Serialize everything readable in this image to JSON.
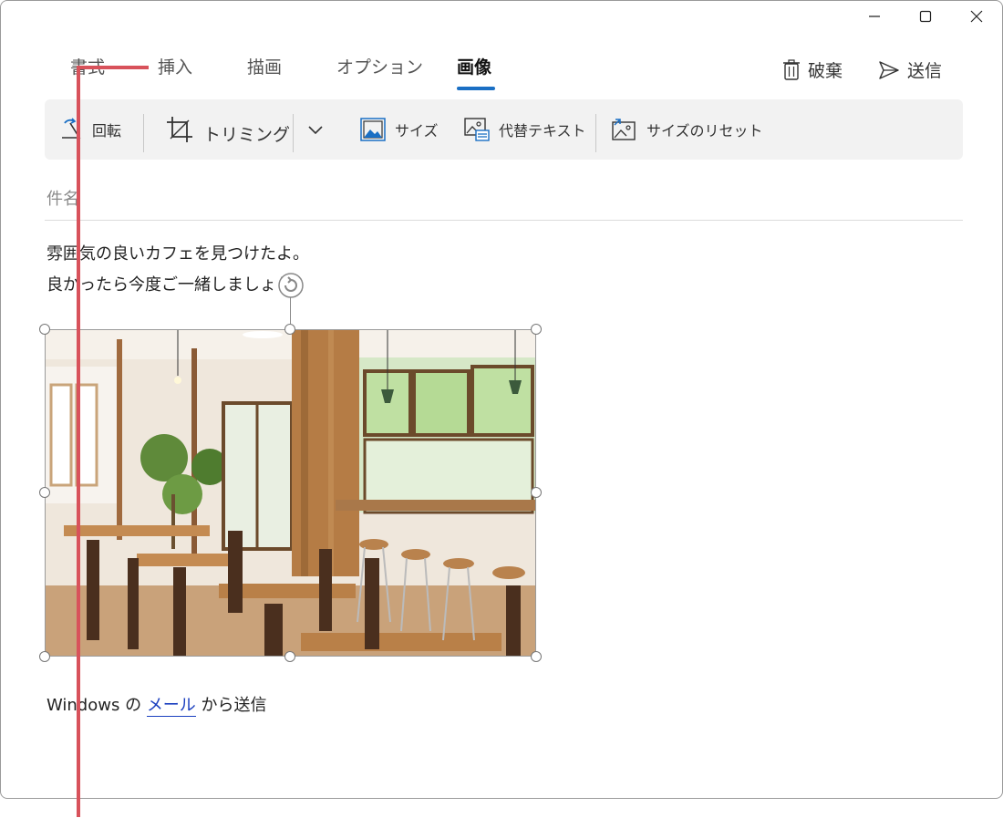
{
  "tabs": [
    "書式",
    "挿入",
    "描画",
    "オプション",
    "画像"
  ],
  "active_tab": "画像",
  "header_actions": {
    "discard_label": "破棄",
    "send_label": "送信"
  },
  "ribbon": {
    "rotate_label": "回転",
    "crop_label": "トリミング",
    "size_label": "サイズ",
    "alt_text_label": "代替テキスト",
    "reset_size_label": "サイズのリセット"
  },
  "subject_placeholder": "件名",
  "body_lines": [
    "雰囲気の良いカフェを見つけたよ。",
    "良かったら今度ご一緒しましょう。"
  ],
  "footer": {
    "prefix": "Windows の",
    "link": "メール",
    "suffix": "から送信"
  },
  "colors": {
    "accent": "#1a6fc4",
    "annotation": "#d8525b",
    "link": "#1a3fbf"
  }
}
